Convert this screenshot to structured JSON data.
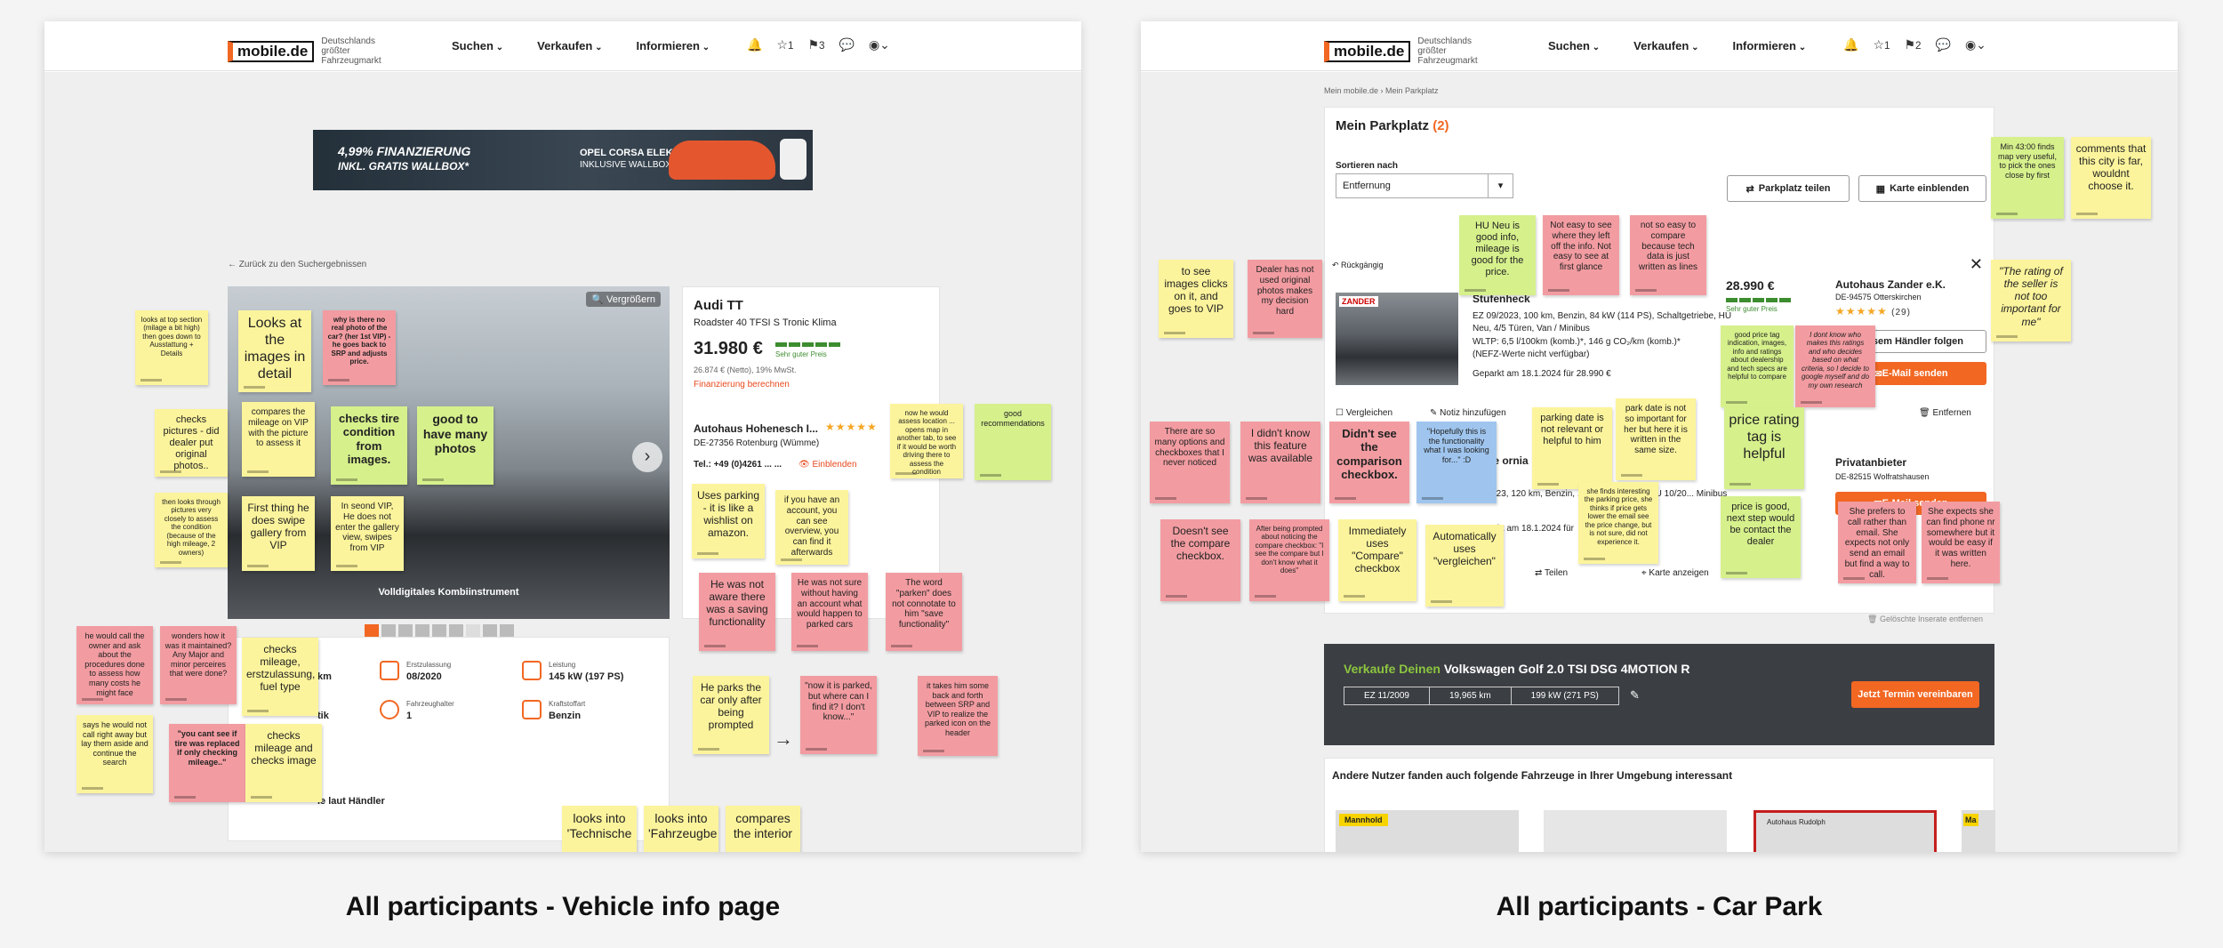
{
  "header": {
    "logo_text": "mobile.de",
    "logo_tagline": "Deutschlands größter Fahrzeugmarkt",
    "nav": [
      "Suchen",
      "Verkaufen",
      "Informieren"
    ]
  },
  "left": {
    "caption": "All participants - Vehicle info page",
    "header_counts": {
      "watchlist": "1",
      "parking": "3"
    },
    "banner": {
      "text1": "4,99% FINANZIERUNG",
      "text2": "INKL. GRATIS WALLBOX*",
      "text3": "OPEL CORSA ELEKTRO",
      "text4": "INKLUSIVE WALLBOX*"
    },
    "back_link": "← Zurück zu den Suchergebnissen",
    "gallery": {
      "zoom": "Vergrößern",
      "caption": "Volldigitales Kombiinstrument"
    },
    "listing": {
      "title": "Audi TT",
      "subtitle": "Roadster 40 TFSI S Tronic Klima",
      "price": "31.980 €",
      "price_rating": "Sehr guter Preis",
      "net": "26.874 € (Netto), 19% MwSt.",
      "financing": "Finanzierung berechnen",
      "dealer": "Autohaus Hohenesch I...",
      "dealer_location": "DE-27356 Rotenburg (Wümme)",
      "phone": "Tel.: +49 (0)4261 ... ...",
      "show": "Einblenden"
    },
    "specs": [
      {
        "label": "Erstzulassung",
        "value": "08/2020"
      },
      {
        "label": "Leistung",
        "value": "145 kW (197 PS)"
      },
      {
        "label": "Fahrzeughalter",
        "value": "1"
      },
      {
        "label": "Kraftstoffart",
        "value": "Benzin"
      }
    ],
    "spec_partial": [
      "km",
      "tik",
      "le laut Händler"
    ],
    "notes": [
      "looks at top section (milage a bit high) then goes down to Ausstattung + Details",
      "Looks at the images in detail",
      "why is there no real photo of the car? (her 1st VIP) - he goes back to SRP and adjusts price.",
      "checks pictures - did dealer put original photos..",
      "compares the mileage on VIP with the picture to assess it",
      "checks tire condition from images.",
      "good to have many photos",
      "then looks through pictures very closely to assess the condition (because of the high mileage, 2 owners)",
      "First thing he does swipe gallery from VIP",
      "In seond VIP, He does not enter the gallery view, swipes from VIP",
      "now he would assess location ... opens map in another tab, to see if it would be worth driving there to assess the condition",
      "good recommendations",
      "Uses parking - it is like a wishlist on amazon.",
      "if you have an account, you can see overview, you can find it afterwards",
      "He was not aware there was a saving functionality",
      "He was not sure without having an account what would happen to parked cars",
      "The word \"parken\" does not connotate to him \"save functionality\"",
      "he would call the owner and ask about the procedures done to assess how many costs he might face",
      "wonders how it was it maintained? Any Major and minor perceires that were done?",
      "checks mileage, erstzulassung, fuel type",
      "He parks the car only after being prompted",
      "\"now it is parked, but where can I find it? I don't know...\"",
      "it takes him some back and forth between SRP and VIP to realize the parked icon on the header",
      "says he would not call right away but lay them aside and continue the search",
      "\"you cant see if tire was replaced if only checking mileage..\"",
      "checks mileage and checks image",
      "looks into 'Technische",
      "looks into 'Fahrzeugbe",
      "compares the interior"
    ]
  },
  "right": {
    "caption": "All participants - Car Park",
    "header_counts": {
      "watchlist": "1",
      "parking": "2"
    },
    "breadcrumb": [
      "Mein mobile.de",
      "Mein Parkplatz"
    ],
    "title": "Mein Parkplatz",
    "count": "(2)",
    "sort_label": "Sortieren nach",
    "sort_value": "Entfernung",
    "share": "Parkplatz teilen",
    "map": "Karte einblenden",
    "undo": "Rückgängig",
    "item1": {
      "title_partial": "Stufenheck",
      "specs": "EZ 09/2023, 100 km, Benzin, 84 kW (114 PS), Schaltgetriebe, HU Neu, 4/5 Türen, Van / Minibus",
      "wltp": "WLTP: 6,5 l/100km (komb.)*, 146 g CO₂/km (komb.)*",
      "wltp2": "(NEFZ-Werte nicht verfügbar)",
      "parked": "Geparkt am 18.1.2024 für 28.990 €",
      "price": "28.990 €",
      "rating": "Sehr guter Preis",
      "dealer": "Autohaus Zander e.K.",
      "location": "DE-94575 Otterskirchen",
      "reviews": "(29)",
      "follow": "diesem Händler folgen",
      "email": "E-Mail senden",
      "compare": "Vergleichen",
      "note": "Notiz hinzufügen",
      "remove": "Entfernen",
      "dealer_logo": "ZANDER"
    },
    "item2": {
      "title_partial": "wage ornia",
      "specs": "EZ 2023, 120 km, Benzin, ... Schaltgetriebe, HU 10/20... Minibus",
      "parked": "Geparkt am 18.1.2024 für",
      "seller": "Privatanbieter",
      "location": "DE-82515 Wolfratshausen",
      "email": "E-Mail senden",
      "map": "Karte anzeigen",
      "share": "Teilen"
    },
    "deleted": "Gelöschte Inserate entfernen",
    "sell": {
      "prefix": "Verkaufe Deinen",
      "car": "Volkswagen Golf 2.0 TSI DSG 4MOTION R",
      "ez": "EZ 11/2009",
      "km": "19,965 km",
      "kw": "199 kW (271 PS)",
      "cta": "Jetzt Termin vereinbaren"
    },
    "recommend_title": "Andere Nutzer fanden auch folgende Fahrzeuge in Ihrer Umgebung interessant",
    "rec_logos": [
      "Mannhold",
      "",
      "Autohaus Rudolph",
      "Ma"
    ],
    "notes": [
      "to see images clicks on it, and goes to VIP",
      "Dealer has not used original photos makes my decision hard",
      "HU Neu is good info, mileage is good for the price.",
      "Not easy to see where they left off the info. Not easy to see at first glance",
      "not so easy to compare because tech data is just written as lines",
      "good price tag indication, images, info and ratings about dealership and tech specs are helpful to compare",
      "I dont know who makes this ratings and who decides based on what criteria, so I decide to google myself and do my own research",
      "Min 43:00 finds map very useful, to pick the ones close by first",
      "comments that this city is far, wouldnt choose it.",
      "\"The rating of the seller is not too important for me\"",
      "There are so many options and checkboxes that I never noticed",
      "I didn't know this feature was available",
      "Didn't see the comparison checkbox.",
      "\"Hopefully this is the functionality what I was looking for...\" :D",
      "parking date is not relevant or helpful to him",
      "park date is not so important for her but here it is written in the same size.",
      "price rating tag is helpful",
      "she finds interesting the parking price, she thinks if price gets lower the email see the price change, but is not sure, did not experience it.",
      "price is good, next step would be contact the dealer",
      "She prefers to call rather than email. She expects not only send an email but find a way to call.",
      "She expects she can find phone nr somewhere but it would be easy if it was written here.",
      "Doesn't see the compare checkbox.",
      "After being prompted about noticing the compare checkbox: \"I see the compare but I don't know what it does\"",
      "Immediately uses \"Compare\" checkbox",
      "Automatically uses \"vergleichen\""
    ]
  }
}
